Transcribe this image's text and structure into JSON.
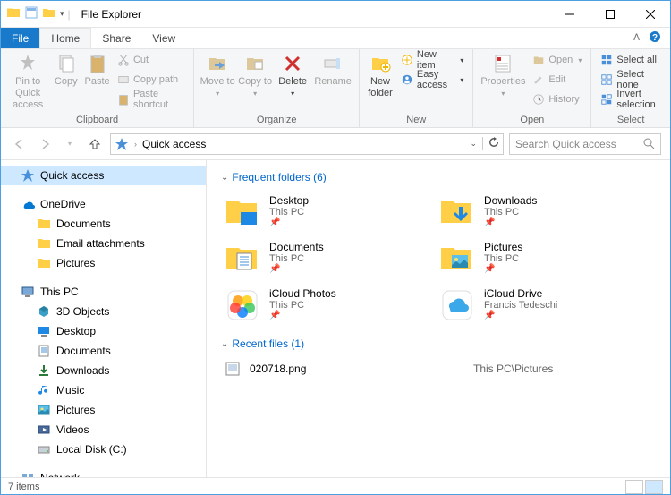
{
  "window": {
    "title": "File Explorer"
  },
  "tabs": {
    "file": "File",
    "home": "Home",
    "share": "Share",
    "view": "View"
  },
  "ribbon": {
    "clipboard": {
      "label": "Clipboard",
      "pin": "Pin to Quick access",
      "copy": "Copy",
      "paste": "Paste",
      "cut": "Cut",
      "copypath": "Copy path",
      "pasteshortcut": "Paste shortcut"
    },
    "organize": {
      "label": "Organize",
      "moveto": "Move to",
      "copyto": "Copy to",
      "delete": "Delete",
      "rename": "Rename"
    },
    "new": {
      "label": "New",
      "newfolder": "New folder",
      "newitem": "New item",
      "easyaccess": "Easy access"
    },
    "open": {
      "label": "Open",
      "properties": "Properties",
      "open": "Open",
      "edit": "Edit",
      "history": "History"
    },
    "select": {
      "label": "Select",
      "all": "Select all",
      "none": "Select none",
      "invert": "Invert selection"
    }
  },
  "addr": {
    "path": "Quick access",
    "search_placeholder": "Search Quick access"
  },
  "sidebar": {
    "quick": "Quick access",
    "onedrive": "OneDrive",
    "onedrive_items": [
      "Documents",
      "Email attachments",
      "Pictures"
    ],
    "thispc": "This PC",
    "thispc_items": [
      "3D Objects",
      "Desktop",
      "Documents",
      "Downloads",
      "Music",
      "Pictures",
      "Videos",
      "Local Disk (C:)"
    ],
    "network": "Network"
  },
  "main": {
    "freq_hdr": "Frequent folders (6)",
    "folders": [
      {
        "name": "Desktop",
        "sub": "This PC",
        "type": "desktop"
      },
      {
        "name": "Downloads",
        "sub": "This PC",
        "type": "downloads"
      },
      {
        "name": "Documents",
        "sub": "This PC",
        "type": "documents"
      },
      {
        "name": "Pictures",
        "sub": "This PC",
        "type": "pictures"
      },
      {
        "name": "iCloud Photos",
        "sub": "This PC",
        "type": "icloudphotos"
      },
      {
        "name": "iCloud Drive",
        "sub": "Francis Tedeschi",
        "type": "iclouddrive"
      }
    ],
    "recent_hdr": "Recent files (1)",
    "recent": {
      "name": "020718.png",
      "path": "This PC\\Pictures"
    }
  },
  "status": {
    "text": "7 items"
  }
}
